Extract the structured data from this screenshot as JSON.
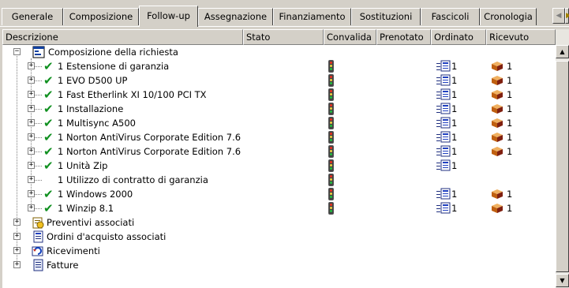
{
  "tabs": [
    {
      "label": "Generale",
      "active": false
    },
    {
      "label": "Composizione",
      "active": false
    },
    {
      "label": "Follow-up",
      "active": true
    },
    {
      "label": "Assegnazione",
      "active": false
    },
    {
      "label": "Finanziamento",
      "active": false
    },
    {
      "label": "Sostituzioni",
      "active": false
    },
    {
      "label": "Fascicoli",
      "active": false
    },
    {
      "label": "Cronologia",
      "active": false
    }
  ],
  "columns": {
    "descrizione": "Descrizione",
    "stato": "Stato",
    "convalida": "Convalida",
    "prenotato": "Prenotato",
    "ordinato": "Ordinato",
    "ricevuto": "Ricevuto"
  },
  "tree": {
    "root": {
      "label": "Composizione della richiesta",
      "expander": "−",
      "icon": "request-composition-icon"
    },
    "items": [
      {
        "label": "1 Estensione di garanzia",
        "checked": true,
        "ordinato": "1",
        "ricevuto": "1"
      },
      {
        "label": "1 EVO D500 UP",
        "checked": true,
        "ordinato": "1",
        "ricevuto": "1"
      },
      {
        "label": "1 Fast Etherlink XI 10/100 PCI TX",
        "checked": true,
        "ordinato": "1",
        "ricevuto": "1"
      },
      {
        "label": "1 Installazione",
        "checked": true,
        "ordinato": "1",
        "ricevuto": "1"
      },
      {
        "label": "1 Multisync A500",
        "checked": true,
        "ordinato": "1",
        "ricevuto": "1"
      },
      {
        "label": "1 Norton AntiVirus Corporate Edition 7.6",
        "checked": true,
        "ordinato": "1",
        "ricevuto": "1"
      },
      {
        "label": "1 Norton AntiVirus Corporate Edition 7.6",
        "checked": true,
        "ordinato": "1",
        "ricevuto": "1"
      },
      {
        "label": "1 Unità Zip",
        "checked": true,
        "ordinato": "1",
        "ricevuto": ""
      },
      {
        "label": "1 Utilizzo di contratto di garanzia",
        "checked": false,
        "ordinato": "",
        "ricevuto": ""
      },
      {
        "label": "1 Windows 2000",
        "checked": true,
        "ordinato": "1",
        "ricevuto": "1"
      },
      {
        "label": "1 Winzip 8.1",
        "checked": true,
        "ordinato": "1",
        "ricevuto": "1"
      }
    ],
    "others": [
      {
        "label": "Preventivi associati",
        "expander": "+",
        "icon": "quotes-icon"
      },
      {
        "label": "Ordini d'acquisto associati",
        "expander": "+",
        "icon": "purchase-orders-icon"
      },
      {
        "label": "Ricevimenti",
        "expander": "+",
        "icon": "receipts-icon"
      },
      {
        "label": "Fatture",
        "expander": "+",
        "icon": "invoices-icon"
      }
    ]
  },
  "tab_scroll": {
    "left": "◀",
    "right": "▶"
  },
  "scrollbar": {
    "up": "▲",
    "down": "▼"
  },
  "colors": {
    "check": "#109020",
    "traffic_frame": "#444444"
  }
}
